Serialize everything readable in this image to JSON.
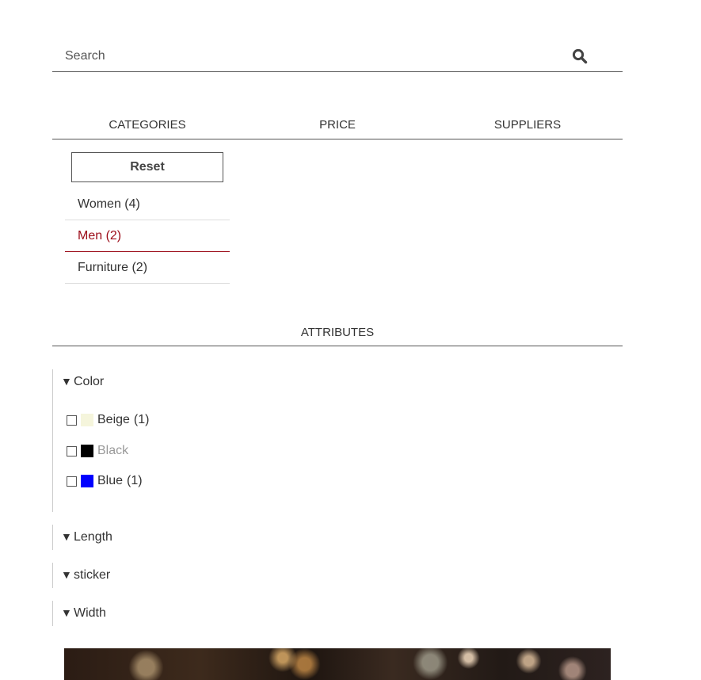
{
  "search": {
    "placeholder": "Search",
    "icon": "search-icon"
  },
  "tabs": [
    {
      "label": "CATEGORIES"
    },
    {
      "label": "PRICE"
    },
    {
      "label": "SUPPLIERS"
    }
  ],
  "categories": {
    "reset_label": "Reset",
    "items": [
      {
        "label": "Women (4)"
      },
      {
        "label": "Men (2)"
      },
      {
        "label": "Furniture (2)"
      }
    ]
  },
  "attributes": {
    "heading": "ATTRIBUTES",
    "groups": [
      {
        "name": "Color",
        "arrow": "▼"
      },
      {
        "name": "Length",
        "arrow": "▼"
      },
      {
        "name": "sticker",
        "arrow": "▼"
      },
      {
        "name": "Width",
        "arrow": "▼"
      }
    ],
    "color_options": [
      {
        "label": "Beige",
        "count": "(1)",
        "swatch": "#f5f5dc"
      },
      {
        "label": "Black",
        "count": "",
        "swatch": "#000000"
      },
      {
        "label": "Blue",
        "count": "(1)",
        "swatch": "#0000ff"
      }
    ]
  },
  "colors": {
    "active_category": "#9b0a17"
  }
}
